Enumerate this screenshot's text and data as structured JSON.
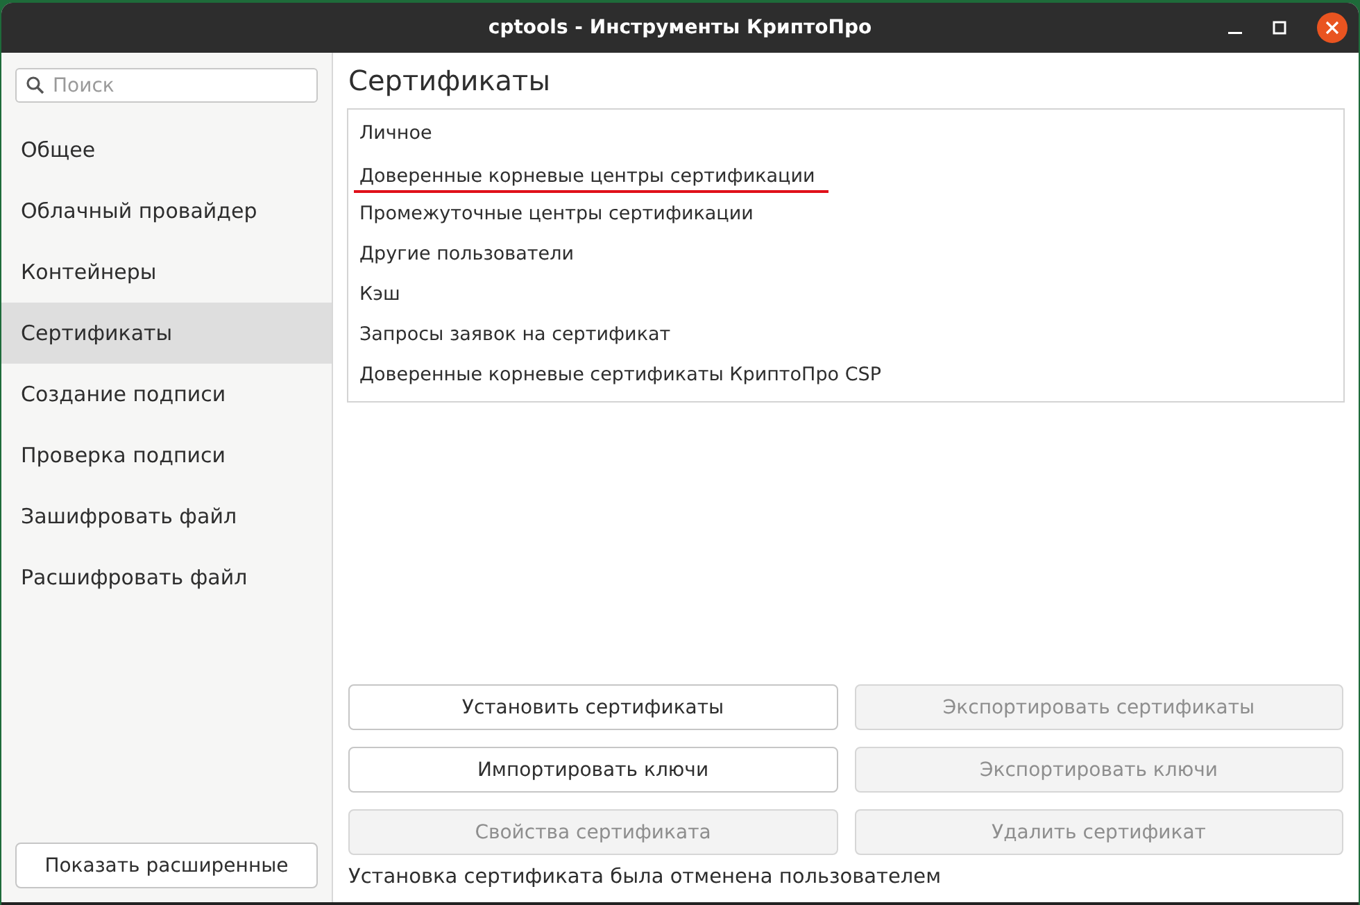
{
  "window": {
    "title": "cptools - Инструменты КриптоПро"
  },
  "sidebar": {
    "search": {
      "placeholder": "Поиск"
    },
    "items": [
      {
        "label": "Общее",
        "selected": false
      },
      {
        "label": "Облачный провайдер",
        "selected": false
      },
      {
        "label": "Контейнеры",
        "selected": false
      },
      {
        "label": "Сертификаты",
        "selected": true
      },
      {
        "label": "Создание подписи",
        "selected": false
      },
      {
        "label": "Проверка подписи",
        "selected": false
      },
      {
        "label": "Зашифровать файл",
        "selected": false
      },
      {
        "label": "Расшифровать файл",
        "selected": false
      }
    ],
    "show_advanced_button": "Показать расширенные"
  },
  "main": {
    "heading": "Сертификаты",
    "stores": [
      {
        "label": "Личное",
        "underlined": false
      },
      {
        "label": "Доверенные корневые центры сертификации",
        "underlined": true
      },
      {
        "label": "Промежуточные центры сертификации",
        "underlined": false
      },
      {
        "label": "Другие пользователи",
        "underlined": false
      },
      {
        "label": "Кэш",
        "underlined": false
      },
      {
        "label": "Запросы заявок на сертификат",
        "underlined": false
      },
      {
        "label": "Доверенные корневые сертификаты КриптоПро CSP",
        "underlined": false
      }
    ],
    "buttons": [
      {
        "label": "Установить сертификаты",
        "disabled": false
      },
      {
        "label": "Экспортировать сертификаты",
        "disabled": true
      },
      {
        "label": "Импортировать ключи",
        "disabled": false
      },
      {
        "label": "Экспортировать ключи",
        "disabled": true
      },
      {
        "label": "Свойства сертификата",
        "disabled": true
      },
      {
        "label": "Удалить сертификат",
        "disabled": true
      }
    ],
    "status": "Установка сертификата была отменена пользователем"
  }
}
